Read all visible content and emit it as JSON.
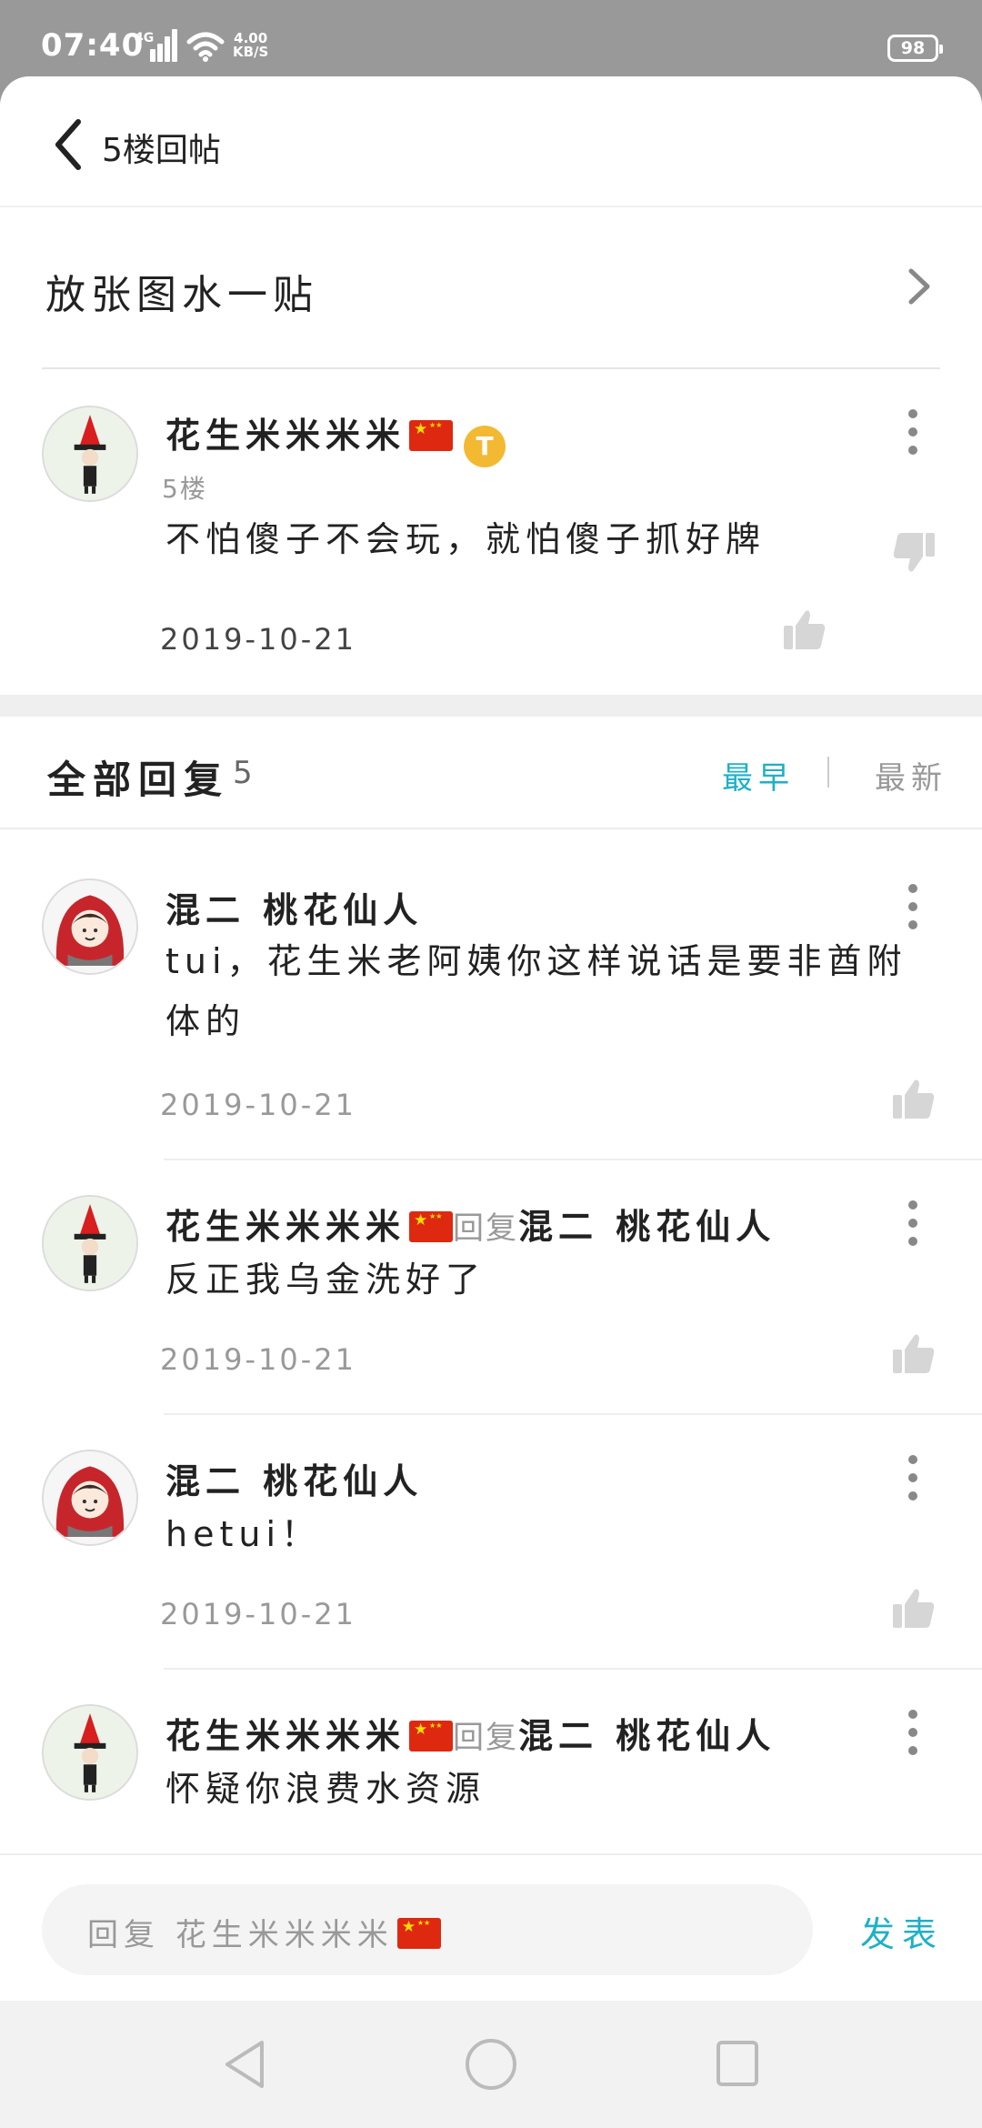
{
  "status_bar": {
    "time": "07:40",
    "network": "4G",
    "speed_value": "4.00",
    "speed_unit": "KB/S",
    "battery": "98"
  },
  "header": {
    "title": "5楼回帖"
  },
  "thread": {
    "title": "放张图水一贴"
  },
  "floor_post": {
    "author": "花生米米米米",
    "badge": "T",
    "floor": "5楼",
    "content": "不怕傻子不会玩，就怕傻子抓好牌",
    "date": "2019-10-21"
  },
  "replies_header": {
    "label": "全部回复",
    "count": "5",
    "sort_earliest": "最早",
    "sort_newest": "最新"
  },
  "replies": [
    {
      "author": "混二 桃花仙人",
      "content_line1": "tui，花生米老阿姨你这样说话是要非酋附",
      "content_line2": "体的",
      "date": "2019-10-21"
    },
    {
      "author": "花生米米米米",
      "reply_word": "回复",
      "reply_to": "混二 桃花仙人",
      "content": "反正我乌金洗好了",
      "date": "2019-10-21"
    },
    {
      "author": "混二 桃花仙人",
      "content": "hetui！",
      "date": "2019-10-21"
    },
    {
      "author": "花生米米米米",
      "reply_word": "回复",
      "reply_to": "混二 桃花仙人",
      "content": "怀疑你浪费水资源"
    }
  ],
  "reply_bar": {
    "placeholder": "回复 花生米米米米",
    "send_label": "发表"
  },
  "colors": {
    "accent": "#1fb0c8",
    "flag": "#de2910",
    "badge": "#f3b933"
  },
  "icons": [
    "back-icon",
    "chevron-right-icon",
    "more-icon",
    "thumb-up-icon",
    "thumb-down-icon",
    "nav-back-icon",
    "nav-home-icon",
    "nav-recent-icon"
  ]
}
